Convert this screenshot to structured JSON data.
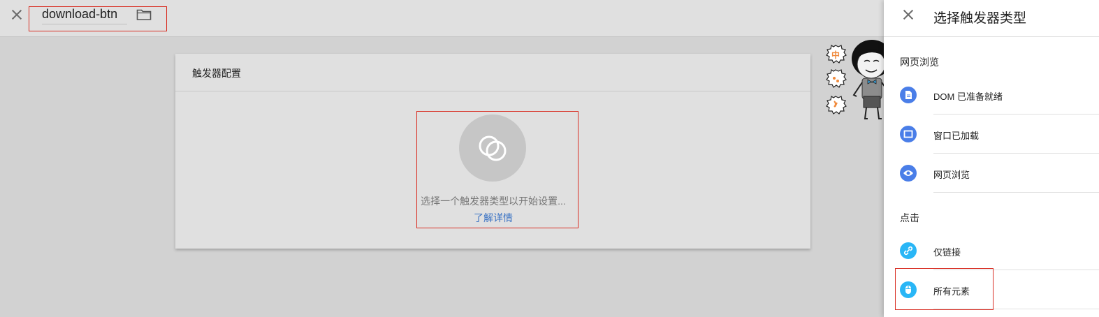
{
  "topbar": {
    "trigger_name": "download-btn"
  },
  "card": {
    "header": "触发器配置",
    "empty_text": "选择一个触发器类型以开始设置...",
    "learn_more": "了解详情"
  },
  "panel": {
    "title": "选择触发器类型",
    "sections": [
      {
        "title": "网页浏览",
        "items": [
          {
            "label": "DOM 已准备就绪",
            "icon": "document-icon",
            "color": "#4a7ee8"
          },
          {
            "label": "窗口已加载",
            "icon": "window-icon",
            "color": "#4a7ee8"
          },
          {
            "label": "网页浏览",
            "icon": "eye-icon",
            "color": "#4a7ee8"
          }
        ]
      },
      {
        "title": "点击",
        "items": [
          {
            "label": "仅链接",
            "icon": "link-icon",
            "color": "#29b6f6"
          },
          {
            "label": "所有元素",
            "icon": "mouse-icon",
            "color": "#29b6f6"
          }
        ]
      }
    ]
  },
  "sticker": {
    "badges": [
      "中"
    ]
  },
  "colors": {
    "highlight": "#d93025",
    "link": "#3b73c4",
    "pageview_icon": "#4a7ee8",
    "click_icon": "#29b6f6"
  }
}
